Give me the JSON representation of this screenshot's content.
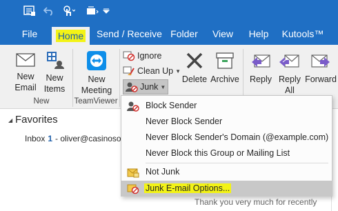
{
  "colors": {
    "accent": "#1f6fc4",
    "highlight": "#f3f316",
    "menu_hover": "#c8c8c8"
  },
  "qat": {
    "icons": [
      "send-receive-icon",
      "undo-icon",
      "touch-mode-icon",
      "customize-icon"
    ]
  },
  "menu": {
    "tabs": [
      "File",
      "Home",
      "Send / Receive",
      "Folder",
      "View",
      "Help",
      "Kutools™"
    ],
    "active": "Home"
  },
  "ribbon": {
    "new_email": "New\nEmail",
    "new_items": "New\nItems",
    "new_group": "New",
    "new_meeting": "New\nMeeting",
    "teamviewer_group": "TeamViewer",
    "ignore": "Ignore",
    "clean_up": "Clean Up",
    "junk": "Junk",
    "delete": "Delete",
    "archive": "Archive",
    "reply": "Reply",
    "reply_all": "Reply\nAll",
    "forward": "Forward"
  },
  "nav": {
    "favorites": "Favorites",
    "inbox": "Inbox",
    "inbox_count": "1",
    "inbox_account": "- oliver@casinosoft"
  },
  "preview_snippet": "Thank you very much for recently",
  "junk_menu": {
    "items": [
      {
        "label": "Block Sender",
        "icon": "block-sender-icon"
      },
      {
        "label": "Never Block Sender",
        "icon": ""
      },
      {
        "label": "Never Block Sender's Domain (@example.com)",
        "icon": ""
      },
      {
        "label": "Never Block this Group or Mailing List",
        "icon": ""
      },
      {
        "label": "Not Junk",
        "icon": "not-junk-icon"
      },
      {
        "label": "Junk E-mail Options...",
        "icon": "junk-options-icon",
        "selected": true
      }
    ]
  }
}
